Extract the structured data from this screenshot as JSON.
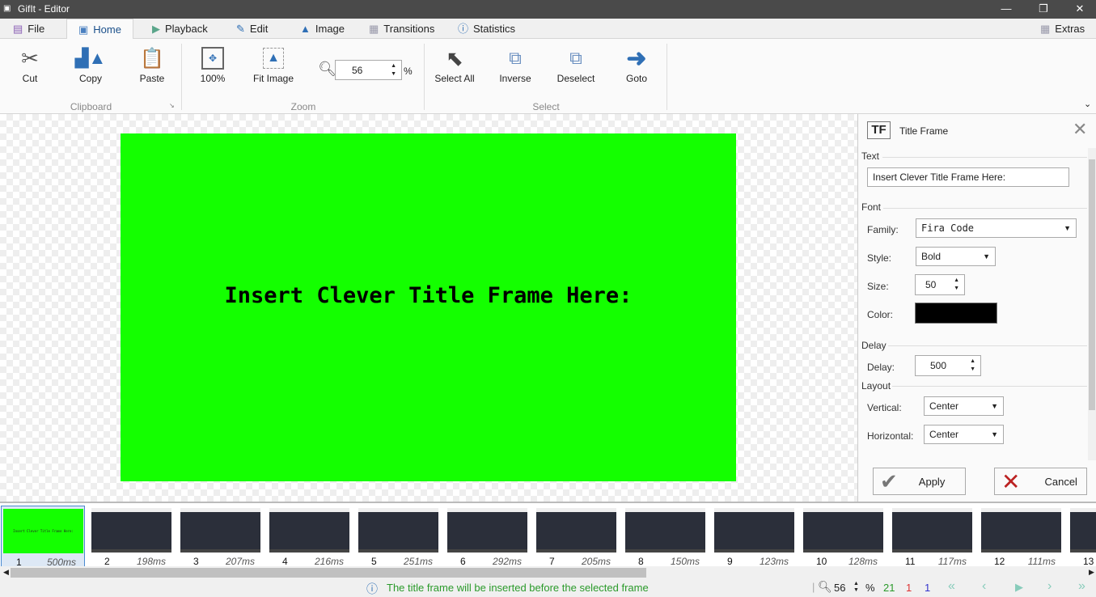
{
  "window": {
    "title": "GifIt - Editor"
  },
  "tabs": [
    {
      "label": "File",
      "icon": "save-icon"
    },
    {
      "label": "Home",
      "icon": "home-icon"
    },
    {
      "label": "Playback",
      "icon": "play-icon"
    },
    {
      "label": "Edit",
      "icon": "pencil-icon"
    },
    {
      "label": "Image",
      "icon": "image-icon"
    },
    {
      "label": "Transitions",
      "icon": "transitions-icon"
    },
    {
      "label": "Statistics",
      "icon": "info-icon"
    }
  ],
  "extras_label": "Extras",
  "ribbon": {
    "clipboard": {
      "label": "Clipboard",
      "cut": "Cut",
      "copy": "Copy",
      "paste": "Paste"
    },
    "zoom": {
      "label": "Zoom",
      "full": "100%",
      "fit": "Fit Image",
      "value": "56",
      "unit": "%"
    },
    "select": {
      "label": "Select",
      "all": "Select All",
      "inverse": "Inverse",
      "deselect": "Deselect",
      "goto": "Goto"
    }
  },
  "canvas": {
    "title_text": "Insert Clever Title Frame Here:",
    "bg_color": "#14ff00"
  },
  "panel": {
    "title": "Title Frame",
    "icon_text": "TF",
    "text_section": "Text",
    "text_value": "Insert Clever Title Frame Here:",
    "font_section": "Font",
    "family_label": "Family:",
    "family_value": "Fira Code",
    "style_label": "Style:",
    "style_value": "Bold",
    "size_label": "Size:",
    "size_value": "50",
    "color_label": "Color:",
    "color_value": "#000000",
    "delay_section": "Delay",
    "delay_label": "Delay:",
    "delay_value": "500",
    "layout_section": "Layout",
    "vertical_label": "Vertical:",
    "vertical_value": "Center",
    "horizontal_label": "Horizontal:",
    "horizontal_value": "Center",
    "apply": "Apply",
    "cancel": "Cancel"
  },
  "frames": [
    {
      "n": "1",
      "d": "500ms"
    },
    {
      "n": "2",
      "d": "198ms"
    },
    {
      "n": "3",
      "d": "207ms"
    },
    {
      "n": "4",
      "d": "216ms"
    },
    {
      "n": "5",
      "d": "251ms"
    },
    {
      "n": "6",
      "d": "292ms"
    },
    {
      "n": "7",
      "d": "205ms"
    },
    {
      "n": "8",
      "d": "150ms"
    },
    {
      "n": "9",
      "d": "123ms"
    },
    {
      "n": "10",
      "d": "128ms"
    },
    {
      "n": "11",
      "d": "117ms"
    },
    {
      "n": "12",
      "d": "111ms"
    },
    {
      "n": "13",
      "d": ""
    }
  ],
  "status": {
    "message": "The title frame will be inserted before the selected frame",
    "zoom": "56",
    "unit": "%",
    "total": "21",
    "selected": "1",
    "current": "1"
  }
}
